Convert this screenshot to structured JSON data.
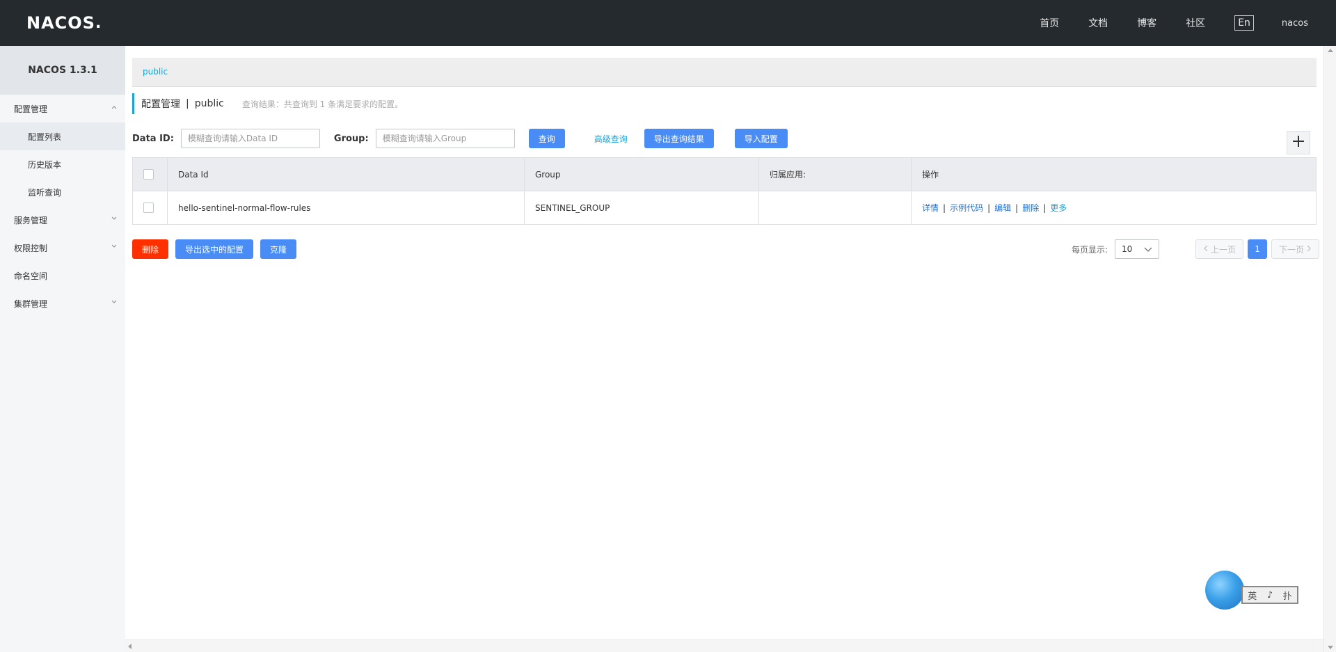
{
  "header": {
    "logo": "NACOS",
    "nav": [
      "首页",
      "文档",
      "博客",
      "社区"
    ],
    "lang": "En",
    "user": "nacos"
  },
  "sidebar": {
    "title": "NACOS 1.3.1",
    "menu": {
      "config_mgmt": "配置管理",
      "config_list": "配置列表",
      "history": "历史版本",
      "listen_query": "监听查询",
      "service_mgmt": "服务管理",
      "permission": "权限控制",
      "namespace": "命名空间",
      "cluster": "集群管理"
    }
  },
  "breadcrumb": {
    "namespace": "public"
  },
  "page": {
    "title": "配置管理",
    "separator": "|",
    "namespace": "public",
    "result_text": "查询结果：共查询到 1 条满足要求的配置。"
  },
  "search": {
    "data_id_label": "Data ID:",
    "data_id_placeholder": "模糊查询请输入Data ID",
    "group_label": "Group:",
    "group_placeholder": "模糊查询请输入Group",
    "query_btn": "查询",
    "advanced_link": "高级查询",
    "export_result_btn": "导出查询结果",
    "import_btn": "导入配置"
  },
  "table": {
    "headers": [
      "Data Id",
      "Group",
      "归属应用:",
      "操作"
    ],
    "rows": [
      {
        "data_id": "hello-sentinel-normal-flow-rules",
        "group": "SENTINEL_GROUP",
        "app": "",
        "ops": [
          "详情",
          "示例代码",
          "编辑",
          "删除",
          "更多"
        ]
      }
    ]
  },
  "bottom": {
    "delete_btn": "删除",
    "export_selected_btn": "导出选中的配置",
    "clone_btn": "克隆"
  },
  "pager": {
    "label": "每页显示:",
    "page_size": "10",
    "prev": "上一页",
    "current": "1",
    "next": "下一页"
  },
  "ime": {
    "chars": [
      "英",
      "♪",
      "扑"
    ]
  },
  "colors": {
    "header_bg": "#252a2f",
    "primary": "#4a8cf6",
    "danger": "#ff3000",
    "link": "#1aa3d6"
  }
}
